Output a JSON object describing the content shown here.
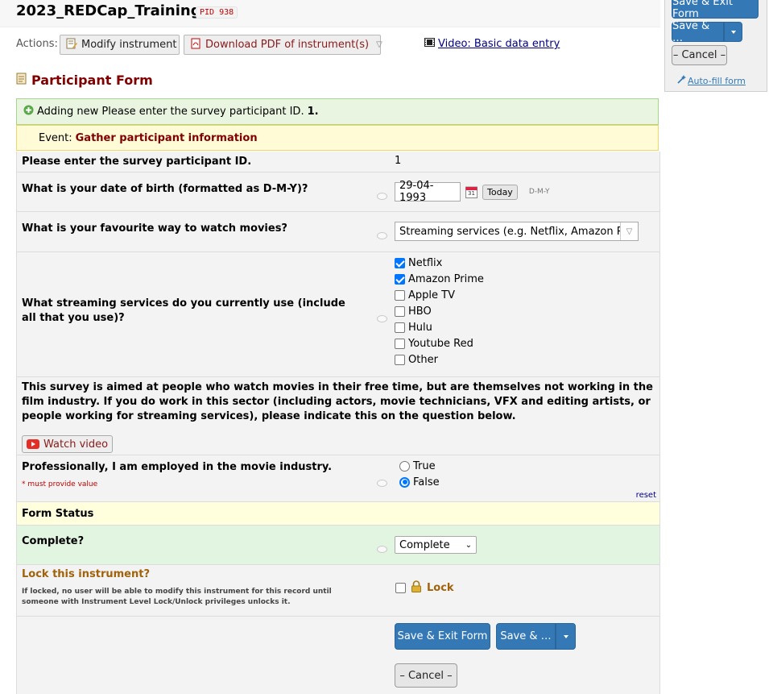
{
  "project": {
    "title": "2023_REDCap_Training",
    "pid": "PID 938"
  },
  "actions": {
    "label": "Actions:",
    "modify": "Modify instrument",
    "download": "Download PDF of instrument(s)",
    "video": "Video: Basic data entry"
  },
  "form": {
    "title": "Participant Form"
  },
  "notice": {
    "prefix": "Adding new Please enter the survey participant ID.",
    "record": "1.",
    "event_label": "Event:",
    "event_name": "Gather participant information"
  },
  "fields": {
    "participant_id": {
      "label": "Please enter the survey participant ID.",
      "value": "1"
    },
    "dob": {
      "label": "What is your date of birth (formatted as D-M-Y)?",
      "value": "29-04-1993",
      "today": "Today",
      "format": "D-M-Y",
      "calendar_day": "31"
    },
    "movies": {
      "label": "What is your favourite way to watch movies?",
      "value": "Streaming services (e.g. Netflix, Amazon Prim"
    },
    "streaming": {
      "label": "What streaming services do you currently use (include all that you use)?",
      "options": [
        {
          "label": "Netflix",
          "checked": true
        },
        {
          "label": "Amazon Prime",
          "checked": true
        },
        {
          "label": "Apple TV",
          "checked": false
        },
        {
          "label": "HBO",
          "checked": false
        },
        {
          "label": "Hulu",
          "checked": false
        },
        {
          "label": "Youtube Red",
          "checked": false
        },
        {
          "label": "Other",
          "checked": false
        }
      ]
    },
    "descriptive": {
      "text": "This survey is aimed at people who watch movies in their free time, but are themselves not working in the film industry. If you do work in this sector (including actors, movie technicians, VFX and editing artists, or people working for streaming services), please indicate this on the question below.",
      "button": "Watch video"
    },
    "employed": {
      "label": "Professionally, I am employed in the movie industry.",
      "required": "* must provide value",
      "options": [
        {
          "label": "True",
          "checked": false
        },
        {
          "label": "False",
          "checked": true
        }
      ],
      "reset": "reset"
    },
    "form_status": {
      "header": "Form Status",
      "label": "Complete?",
      "value": "Complete"
    },
    "lock": {
      "label": "Lock this instrument?",
      "help": "If locked, no user will be able to modify this instrument for this record until someone with Instrument Level Lock/Unlock privileges unlocks it.",
      "lock_text": "Lock"
    }
  },
  "buttons": {
    "save_exit": "Save & Exit Form",
    "save_more": "Save & …",
    "cancel": "– Cancel –",
    "autofill": "Auto-fill form"
  },
  "colors": {
    "accent_blue": "#3479b6",
    "form_title": "#800000",
    "green_notice": "#e9f5e0",
    "yellow_notice": "#fffbd6"
  }
}
